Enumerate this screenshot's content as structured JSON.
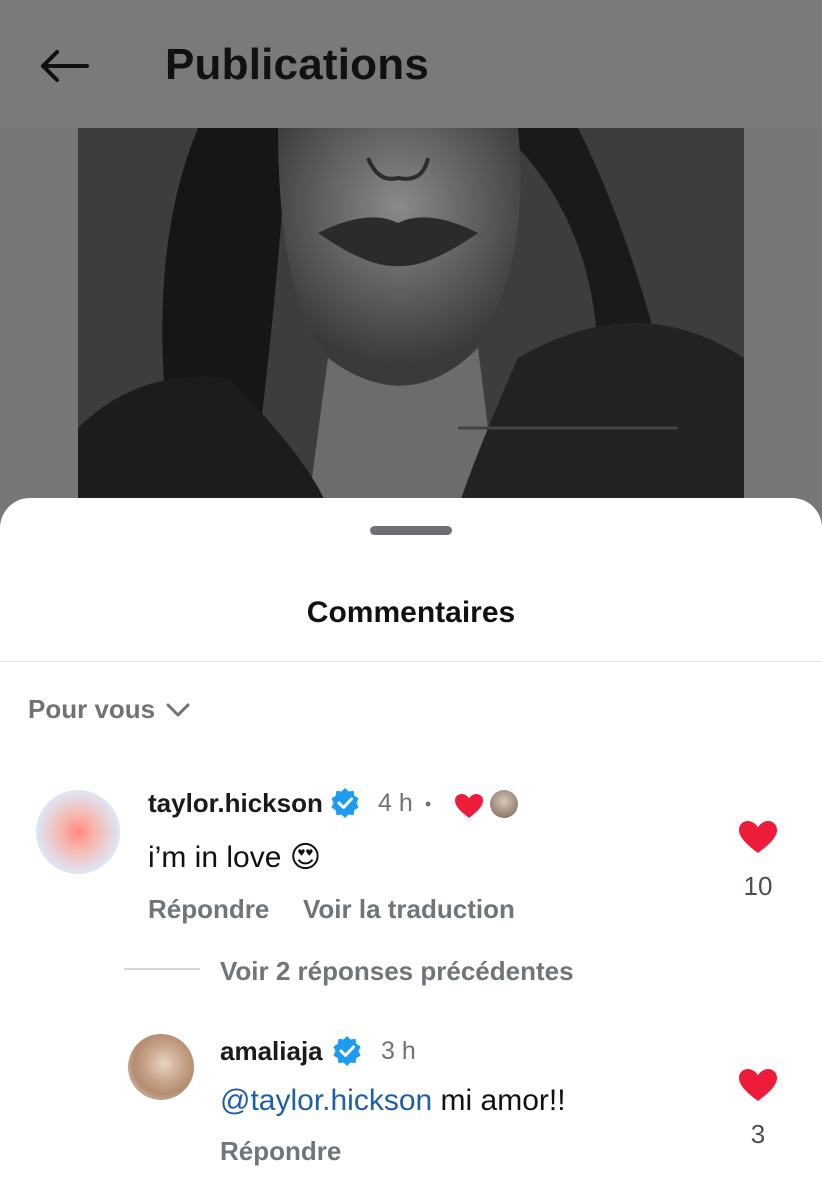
{
  "header": {
    "title": "Publications",
    "back_icon": "arrow-left-icon"
  },
  "post": {
    "image": "black-and-white portrait photo"
  },
  "comments_sheet": {
    "title": "Commentaires",
    "sort_label": "Pour vous",
    "sort_icon": "chevron-down-icon",
    "comments": [
      {
        "username": "taylor.hickson",
        "verified": true,
        "time": "4 h",
        "separator": "•",
        "text": "i’m in love",
        "emoji": "😍",
        "liked_by_author": true,
        "reply_label": "Répondre",
        "translate_label": "Voir la traduction",
        "like_count": "10"
      }
    ],
    "view_replies_label": "Voir 2 réponses précédentes",
    "replies": [
      {
        "username": "amaliaja",
        "verified": true,
        "time": "3 h",
        "mention": "@taylor.hickson",
        "text": " mi amor!!",
        "reply_label": "Répondre",
        "like_count": "3"
      }
    ]
  },
  "colors": {
    "like_red": "#ed1c3a",
    "verified_blue": "#1d9bf0",
    "mention_blue": "#1f5ea8"
  }
}
